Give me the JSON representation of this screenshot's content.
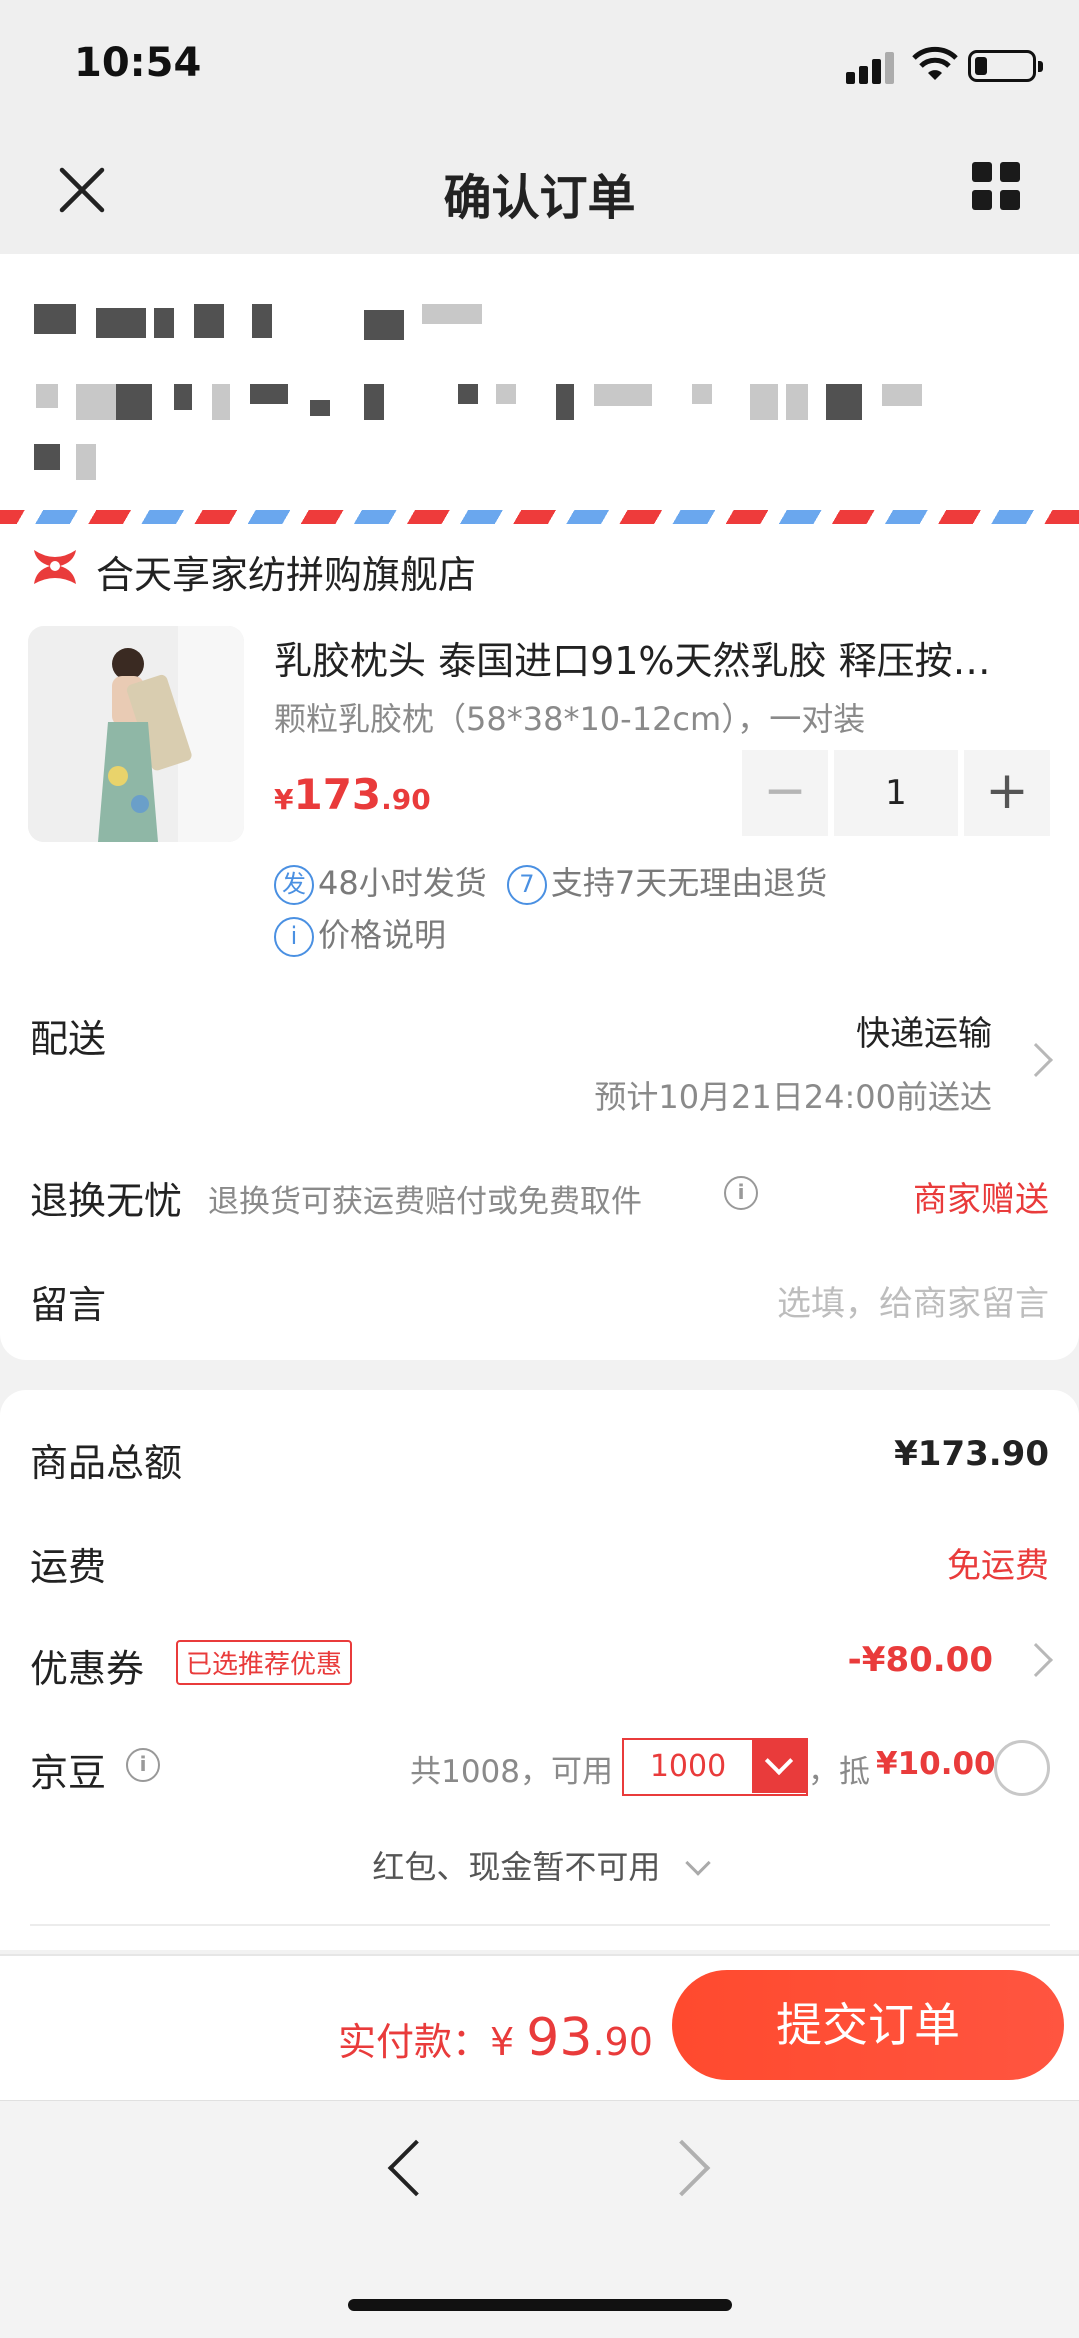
{
  "status_bar": {
    "time": "10:54"
  },
  "nav": {
    "title": "确认订单"
  },
  "shop": {
    "name": "合天享家纺拼购旗舰店"
  },
  "product": {
    "title": "乳胶枕头 泰国进口91%天然乳胶 释压按…",
    "spec": "颗粒乳胶枕（58*38*10-12cm），一对装",
    "price_symbol": "¥",
    "price_int": "173",
    "price_dec": ".90",
    "quantity": "1",
    "minus": "−",
    "plus": "+",
    "tag1_icon": "发",
    "tag1": "48小时发货",
    "tag2_icon": "7",
    "tag2": "支持7天无理由退货",
    "tag3_icon": "i",
    "tag3": "价格说明"
  },
  "delivery": {
    "label": "配送",
    "method": "快递运输",
    "eta": "预计10月21日24:00前送达"
  },
  "return_service": {
    "label": "退换无忧",
    "desc": "退换货可获运费赔付或免费取件",
    "value": "商家赠送"
  },
  "message": {
    "label": "留言",
    "placeholder": "选填，给商家留言"
  },
  "totals": {
    "goods_label": "商品总额",
    "goods_value": "¥173.90",
    "shipping_label": "运费",
    "shipping_value": "免运费",
    "coupon_label": "优惠券",
    "coupon_badge": "已选推荐优惠",
    "coupon_value": "-¥80.00",
    "beans_label": "京豆",
    "beans_prefix": "共1008，可用",
    "beans_selected": "1000",
    "beans_suffix": "，抵",
    "beans_value": "¥10.00",
    "unavailable": "红包、现金暂不可用"
  },
  "bottom": {
    "pay_label": "实付款：",
    "pay_symbol": "¥ ",
    "pay_int": "93",
    "pay_dec": ".90",
    "submit": "提交订单"
  },
  "colors": {
    "accent": "#e93b3b",
    "submit": "#ff4a2e",
    "tag_blue": "#4a90e2"
  }
}
